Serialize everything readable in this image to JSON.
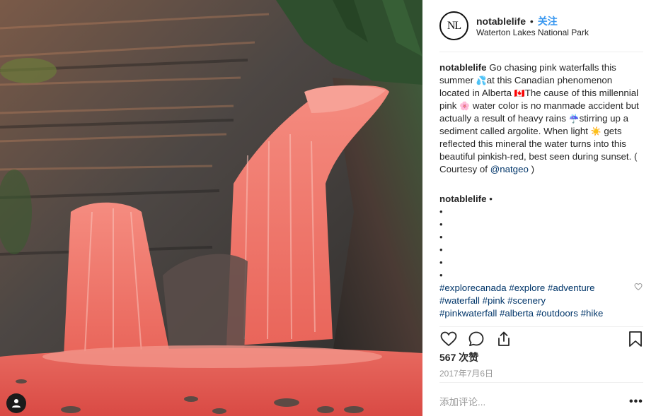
{
  "post": {
    "username": "notablelife",
    "follow_label": "关注",
    "location": "Waterton Lakes National Park",
    "avatar_text": "NL"
  },
  "caption": {
    "username": "notablelife",
    "part1": "Go chasing pink waterfalls this summer",
    "emoji1": "💦",
    "part2": "at this Canadian phenomenon located in Alberta",
    "emoji2": "🇨🇦",
    "part3": "The cause of this millennial pink",
    "emoji3": "🌸",
    "part4": "water color is no manmade accident but actually a result of heavy rains",
    "emoji4": "☔",
    "part5": "stirring up a sediment called argolite. When light",
    "emoji5": "☀️",
    "part6": "gets reflected this mineral the water turns into this beautiful pinkish-red, best seen during sunset. ( Courtesy of",
    "mention": "@natgeo",
    "part7": ")"
  },
  "comment": {
    "username": "notablelife",
    "bullets": [
      "•",
      "•",
      "•",
      "•",
      "•",
      "•"
    ],
    "hashtags_line1": "#explorecanada #explore #adventure",
    "hashtags_line2": "#waterfall #pink #scenery",
    "hashtags_line3": "#pinkwaterfall #alberta #outdoors #hike"
  },
  "stats": {
    "likes": "567 次赞",
    "date": "2017年7月6日"
  },
  "comment_box": {
    "placeholder": "添加评论...",
    "more_label": "•••"
  },
  "icons": {
    "like": "heart-icon",
    "comment": "comment-icon",
    "share": "share-icon",
    "save": "bookmark-icon",
    "small_like": "heart-outline-icon",
    "user_tag": "user-icon"
  }
}
